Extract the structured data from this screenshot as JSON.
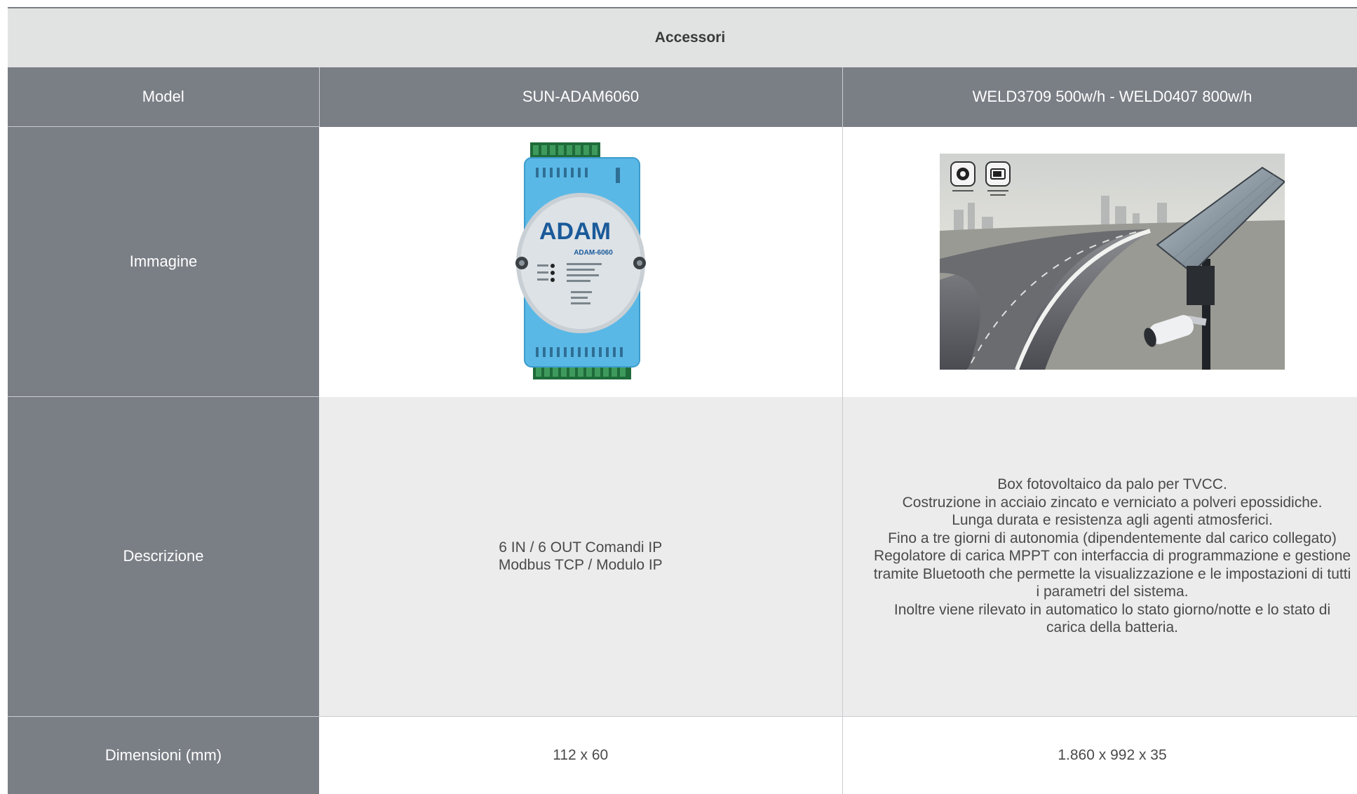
{
  "table": {
    "caption": "Accessori",
    "header": {
      "label": "Model",
      "col1": "SUN-ADAM6060",
      "col2": "WELD3709 500w/h - WELD0407 800w/h"
    },
    "rows": {
      "image": {
        "label": "Immagine",
        "col1_image_text": "ADAM",
        "col1_image_subtext": "ADAM-6060"
      },
      "description": {
        "label": "Descrizione",
        "col1": "6 IN / 6 OUT Comandi IP\nModbus TCP / Modulo IP",
        "col2": "Box fotovoltaico da palo per TVCC.\nCostruzione in acciaio zincato e verniciato a polveri epossidiche.\nLunga durata e resistenza agli agenti atmosferici.\nFino a tre giorni di autonomia (dipendentemente dal carico collegato)\nRegolatore di carica MPPT con interfaccia di programmazione e gestione\ntramite Bluetooth che permette la visualizzazione e le impostazioni di tutti\ni parametri del sistema.\nInoltre viene rilevato in automatico lo stato giorno/notte e lo stato di\ncarica della batteria."
      },
      "dimensions": {
        "label": "Dimensioni (mm)",
        "col1": "112 x 60",
        "col2": "1.860 x 992 x 35"
      }
    }
  },
  "colors": {
    "header_bg": "#7a7e85",
    "caption_bg": "#e1e2e2",
    "desc_bg": "#ececed",
    "module_blue": "#5ab8e6"
  }
}
